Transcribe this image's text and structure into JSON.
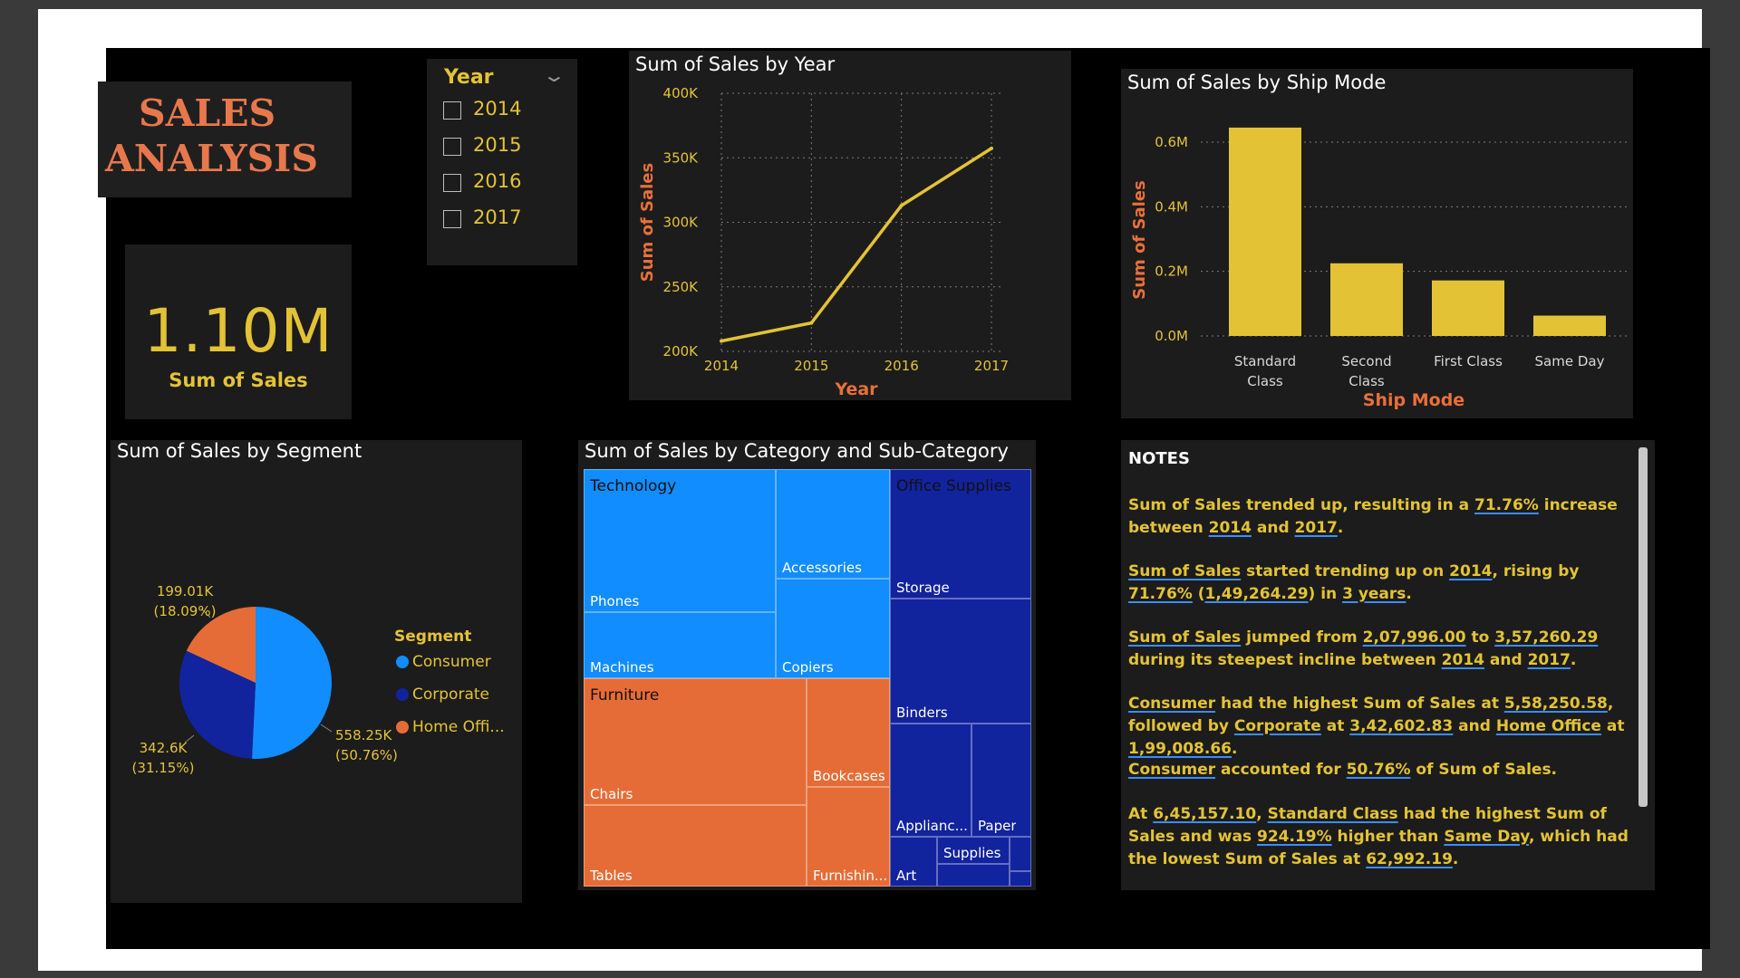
{
  "title": {
    "line1": "SALES",
    "line2": "ANALYSIS"
  },
  "kpi": {
    "value": "1.10M",
    "label": "Sum of Sales"
  },
  "slicer": {
    "header": "Year",
    "options": [
      "2014",
      "2015",
      "2016",
      "2017"
    ]
  },
  "colors": {
    "gold": "#e3c335",
    "orange": "#e8703a",
    "consumer": "#118dff",
    "corporate": "#12239e",
    "home_office": "#e66c37",
    "technology": "#118dff",
    "office_supplies": "#12239e",
    "furniture": "#e66c37"
  },
  "chart_data": [
    {
      "type": "line",
      "title": "Sum of Sales by Year",
      "xlabel": "Year",
      "ylabel": "Sum of Sales",
      "x": [
        "2014",
        "2015",
        "2016",
        "2017"
      ],
      "values": [
        207996,
        222000,
        313000,
        357260.29
      ],
      "ylim": [
        200000,
        400000
      ],
      "yticks": [
        "200K",
        "250K",
        "300K",
        "350K",
        "400K"
      ],
      "grid": true
    },
    {
      "type": "bar",
      "title": "Sum of Sales by Ship Mode",
      "xlabel": "Ship Mode",
      "ylabel": "Sum of Sales",
      "categories": [
        "Standard Class",
        "Second Class",
        "First Class",
        "Same Day"
      ],
      "category_lines": [
        [
          "Standard",
          "Class"
        ],
        [
          "Second",
          "Class"
        ],
        [
          "First Class"
        ],
        [
          "Same Day"
        ]
      ],
      "values": [
        645157.1,
        225000,
        172000,
        62992.19
      ],
      "ylim": [
        0,
        650000
      ],
      "yticks": [
        "0.0M",
        "0.2M",
        "0.4M",
        "0.6M"
      ],
      "grid": true
    },
    {
      "type": "pie",
      "title": "Sum of Sales by Segment",
      "legend_title": "Segment",
      "legend": [
        "Consumer",
        "Corporate",
        "Home Offi..."
      ],
      "categories": [
        "Consumer",
        "Corporate",
        "Home Office"
      ],
      "values": [
        558250.58,
        342602.83,
        199008.66
      ],
      "labels": [
        {
          "value": "558.25K",
          "pct": "(50.76%)"
        },
        {
          "value": "342.6K",
          "pct": "(31.15%)"
        },
        {
          "value": "199.01K",
          "pct": "(18.09%)"
        }
      ]
    },
    {
      "type": "treemap",
      "title": "Sum of Sales by Category and Sub-Category",
      "groups": [
        {
          "name": "Technology",
          "children": [
            "Phones",
            "Machines",
            "Accessories",
            "Copiers"
          ]
        },
        {
          "name": "Furniture",
          "children": [
            "Chairs",
            "Tables",
            "Bookcases",
            "Furnishin..."
          ]
        },
        {
          "name": "Office Supplies",
          "children": [
            "Storage",
            "Binders",
            "Applianc...",
            "Paper",
            "Supplies",
            "Art"
          ]
        }
      ]
    }
  ],
  "notes": {
    "title": "NOTES",
    "items": [
      [
        [
          "Sum of Sales trended up, resulting in a ",
          false
        ],
        [
          "71.76%",
          true
        ],
        [
          " increase between ",
          false
        ],
        [
          "2014",
          true
        ],
        [
          " and ",
          false
        ],
        [
          "2017",
          true
        ],
        [
          ".",
          false
        ]
      ],
      [
        [
          "Sum of Sales",
          true
        ],
        [
          " started trending up on ",
          false
        ],
        [
          "2014",
          true
        ],
        [
          ", rising by ",
          false
        ],
        [
          "71.76%",
          true
        ],
        [
          " (",
          false
        ],
        [
          "1,49,264.29",
          true
        ],
        [
          ") in ",
          false
        ],
        [
          "3 years",
          true
        ],
        [
          ".",
          false
        ]
      ],
      [
        [
          "Sum of Sales",
          true
        ],
        [
          " jumped from ",
          false
        ],
        [
          "2,07,996.00",
          true
        ],
        [
          " to ",
          false
        ],
        [
          "3,57,260.29",
          true
        ],
        [
          " during its steepest incline between ",
          false
        ],
        [
          "2014",
          true
        ],
        [
          " and ",
          false
        ],
        [
          "2017",
          true
        ],
        [
          ".",
          false
        ]
      ],
      [
        [
          "Consumer",
          true
        ],
        [
          " had the highest Sum of Sales at ",
          false
        ],
        [
          "5,58,250.58",
          true
        ],
        [
          ", followed by ",
          false
        ],
        [
          "Corporate",
          true
        ],
        [
          " at ",
          false
        ],
        [
          "3,42,602.83",
          true
        ],
        [
          " and ",
          false
        ],
        [
          "Home Office",
          true
        ],
        [
          " at ",
          false
        ],
        [
          "1,99,008.66",
          true
        ],
        [
          ".",
          false
        ]
      ],
      [
        [
          "Consumer",
          true
        ],
        [
          " accounted for ",
          false
        ],
        [
          "50.76%",
          true
        ],
        [
          " of Sum of Sales.",
          false
        ]
      ],
      [
        [
          "At ",
          false
        ],
        [
          "6,45,157.10",
          true
        ],
        [
          ", ",
          false
        ],
        [
          "Standard Class",
          true
        ],
        [
          " had the highest Sum of Sales and was ",
          false
        ],
        [
          "924.19%",
          true
        ],
        [
          " higher than ",
          false
        ],
        [
          "Same Day",
          true
        ],
        [
          ", which had the lowest Sum of Sales at ",
          false
        ],
        [
          "62,992.19",
          true
        ],
        [
          ".",
          false
        ]
      ]
    ]
  }
}
